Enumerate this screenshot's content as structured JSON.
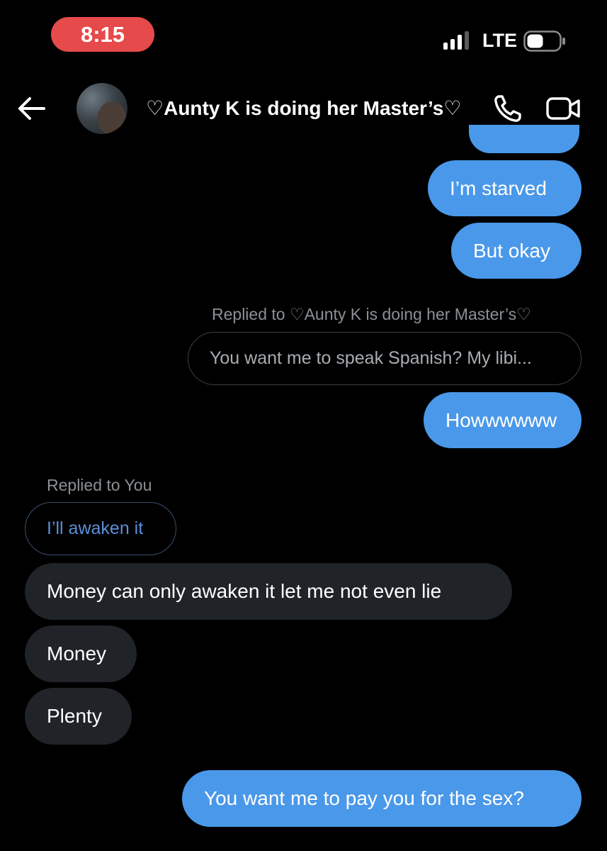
{
  "status_bar": {
    "time": "8:15",
    "network": "LTE",
    "time_pill_color": "#e64a4a"
  },
  "header": {
    "title": "♡Aunty K is doing her Master’s♡",
    "back_icon": "arrow-left-icon",
    "call_icon": "phone-icon",
    "video_icon": "video-camera-icon"
  },
  "messages": {
    "sent_1": "I’m starved",
    "sent_2": "But okay",
    "reply_1_label": "Replied to ♡Aunty K is doing her Master’s♡",
    "reply_1_quote": "You want me to speak Spanish? My libi...",
    "sent_3": "Howwwwww",
    "reply_2_label": "Replied to You",
    "reply_2_quote": "I’ll awaken it",
    "recv_1": "Money can only awaken it let me not even lie",
    "recv_2": "Money",
    "recv_3": "Plenty",
    "sent_4": "You want me to pay you for the sex?"
  },
  "colors": {
    "background": "#000000",
    "sent_bubble": "#4a98e9",
    "received_bubble": "#202327",
    "muted_text": "#8b9095",
    "accent_blue_text": "#5b8fd6"
  }
}
